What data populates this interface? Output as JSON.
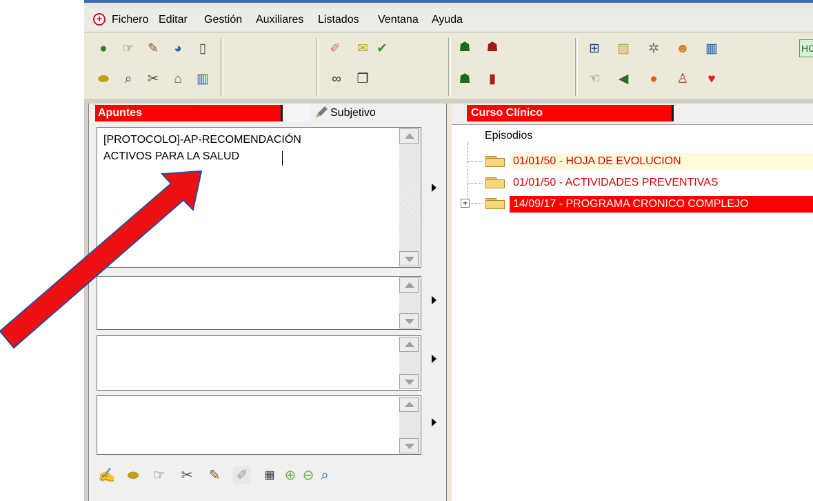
{
  "menu": {
    "items": [
      "Fichero",
      "Editar",
      "Gestión",
      "Auxiliares",
      "Listados",
      "Ventana",
      "Ayuda"
    ]
  },
  "toolbar": {
    "hce_label": "HCE"
  },
  "left_panel": {
    "tab_apuntes": "Apuntes",
    "tab_subjetivo": "Subjetivo",
    "note_text": "[PROTOCOLO]-AP-RECOMENDACIÓN\nACTIVOS PARA LA SALUD"
  },
  "right_panel": {
    "tab_curso": "Curso Clínico",
    "tree_root": "Episodios",
    "episodes": [
      {
        "label": "01/01/50 - HOJA DE EVOLUCION",
        "state": "highlighted"
      },
      {
        "label": "01/01/50 - ACTIVIDADES PREVENTIVAS",
        "state": "normal"
      },
      {
        "label": "14/09/17 - PROGRAMA CRONICO COMPLEJO",
        "state": "selected"
      }
    ]
  },
  "colors": {
    "tab_red": "#ff0000",
    "episode_text": "#e00000",
    "annotation_arrow": "#ee1111"
  }
}
